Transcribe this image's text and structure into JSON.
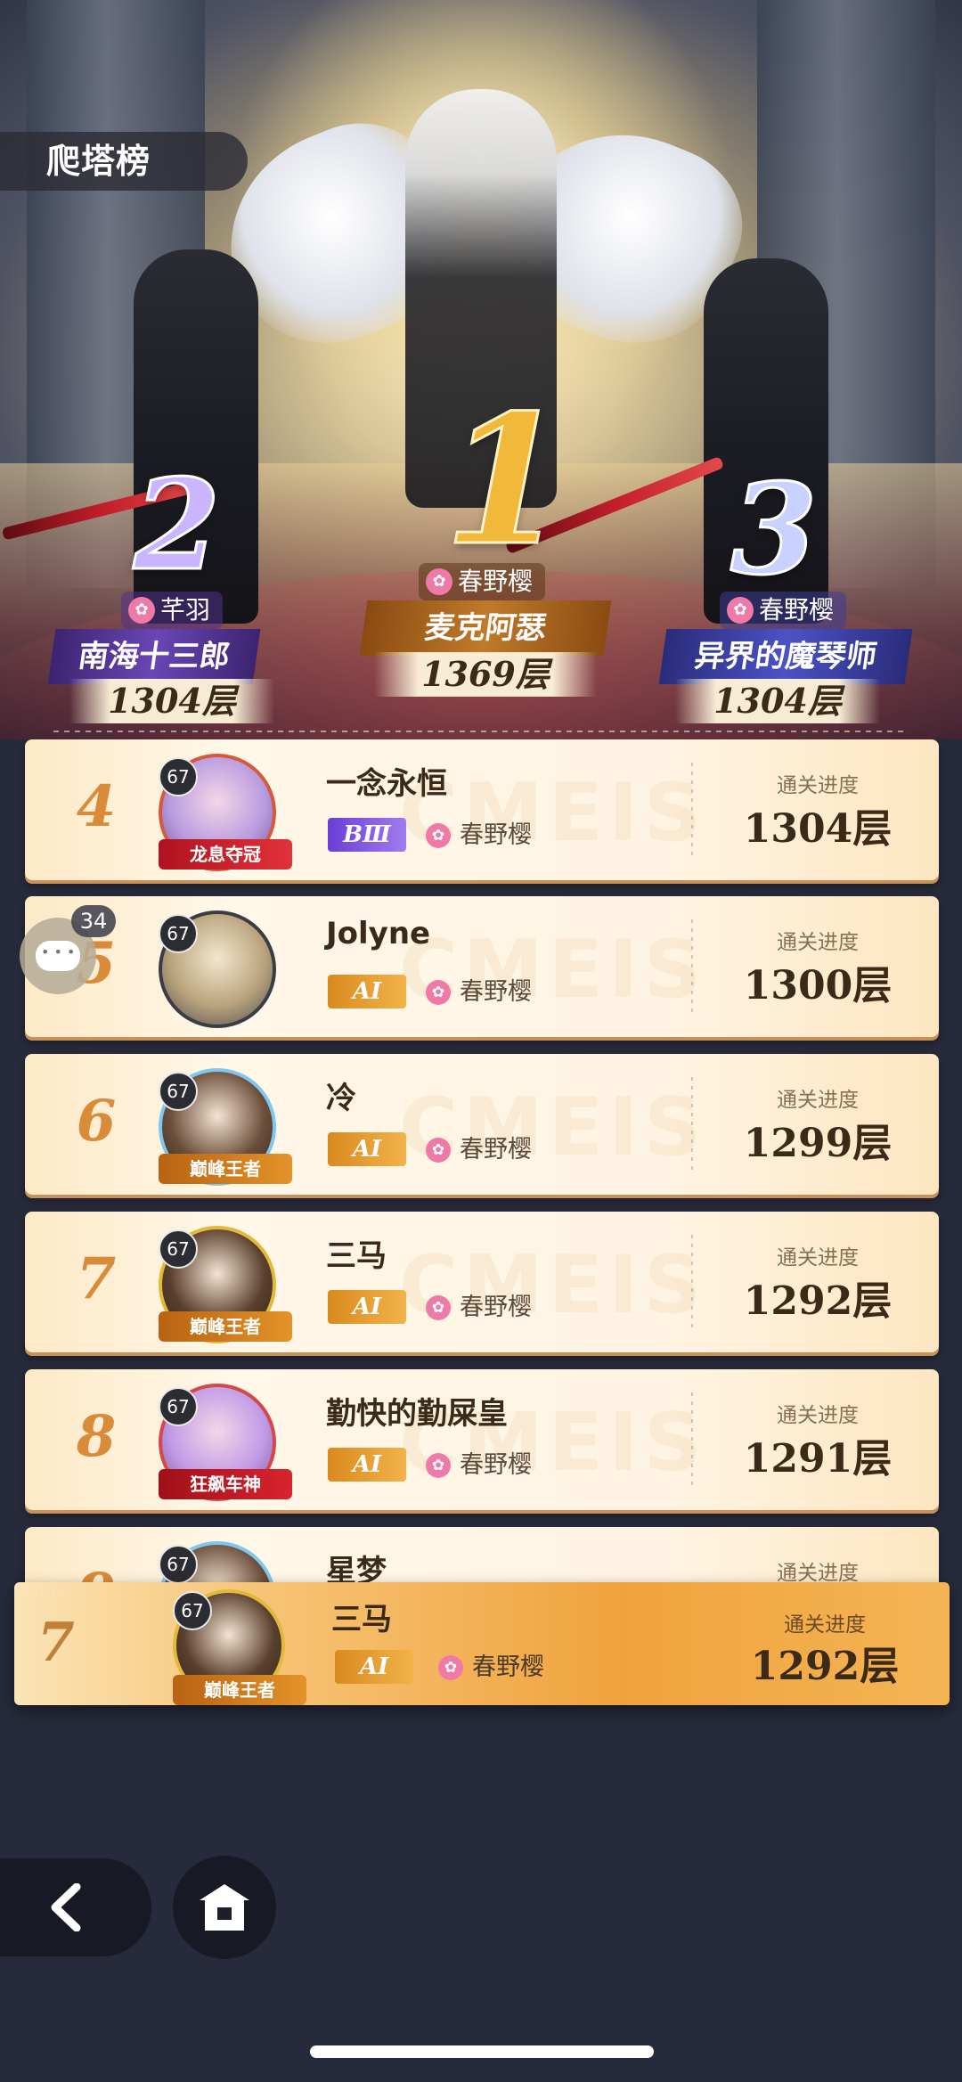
{
  "header": {
    "title": "爬塔榜"
  },
  "podium": [
    {
      "rank": "1",
      "guild": "春野樱",
      "name": "麦克阿瑟",
      "floor": "1369层"
    },
    {
      "rank": "2",
      "guild": "芊羽",
      "name": "南海十三郎",
      "floor": "1304层"
    },
    {
      "rank": "3",
      "guild": "春野樱",
      "name": "异界的魔琴师",
      "floor": "1304层"
    }
  ],
  "progress_label": "通关进度",
  "watermark": "CMEIS",
  "rows": [
    {
      "rank": "4",
      "level": "67",
      "badge": "龙息夺冠",
      "name": "一念永恒",
      "tier": "BⅢ",
      "guild": "春野樱",
      "floor": "1304层"
    },
    {
      "rank": "5",
      "level": "67",
      "badge": "",
      "name": "Jolyne",
      "tier": "AⅠ",
      "guild": "春野樱",
      "floor": "1300层"
    },
    {
      "rank": "6",
      "level": "67",
      "badge": "巅峰王者",
      "name": "冷",
      "tier": "AⅠ",
      "guild": "春野樱",
      "floor": "1299层"
    },
    {
      "rank": "7",
      "level": "67",
      "badge": "巅峰王者",
      "name": "三马",
      "tier": "AⅠ",
      "guild": "春野樱",
      "floor": "1292层"
    },
    {
      "rank": "8",
      "level": "67",
      "badge": "狂飙车神",
      "name": "勤快的勤屎皇",
      "tier": "AⅠ",
      "guild": "春野樱",
      "floor": "1291层"
    },
    {
      "rank": "9",
      "level": "67",
      "badge": "",
      "name": "星梦",
      "tier": "",
      "guild": "",
      "floor": ""
    }
  ],
  "self_row": {
    "rank": "7",
    "level": "67",
    "badge": "巅峰王者",
    "name": "三马",
    "tier": "AⅠ",
    "guild": "春野樱",
    "floor": "1292层"
  },
  "chat": {
    "count": "34"
  },
  "nav": {
    "back_icon": "back-arrow-icon",
    "home_icon": "home-icon"
  },
  "colors": {
    "accent": "#d98b3a",
    "row_bg": "#fff4e3",
    "self_bg": "#f0a33d",
    "background": "#262a3a"
  }
}
